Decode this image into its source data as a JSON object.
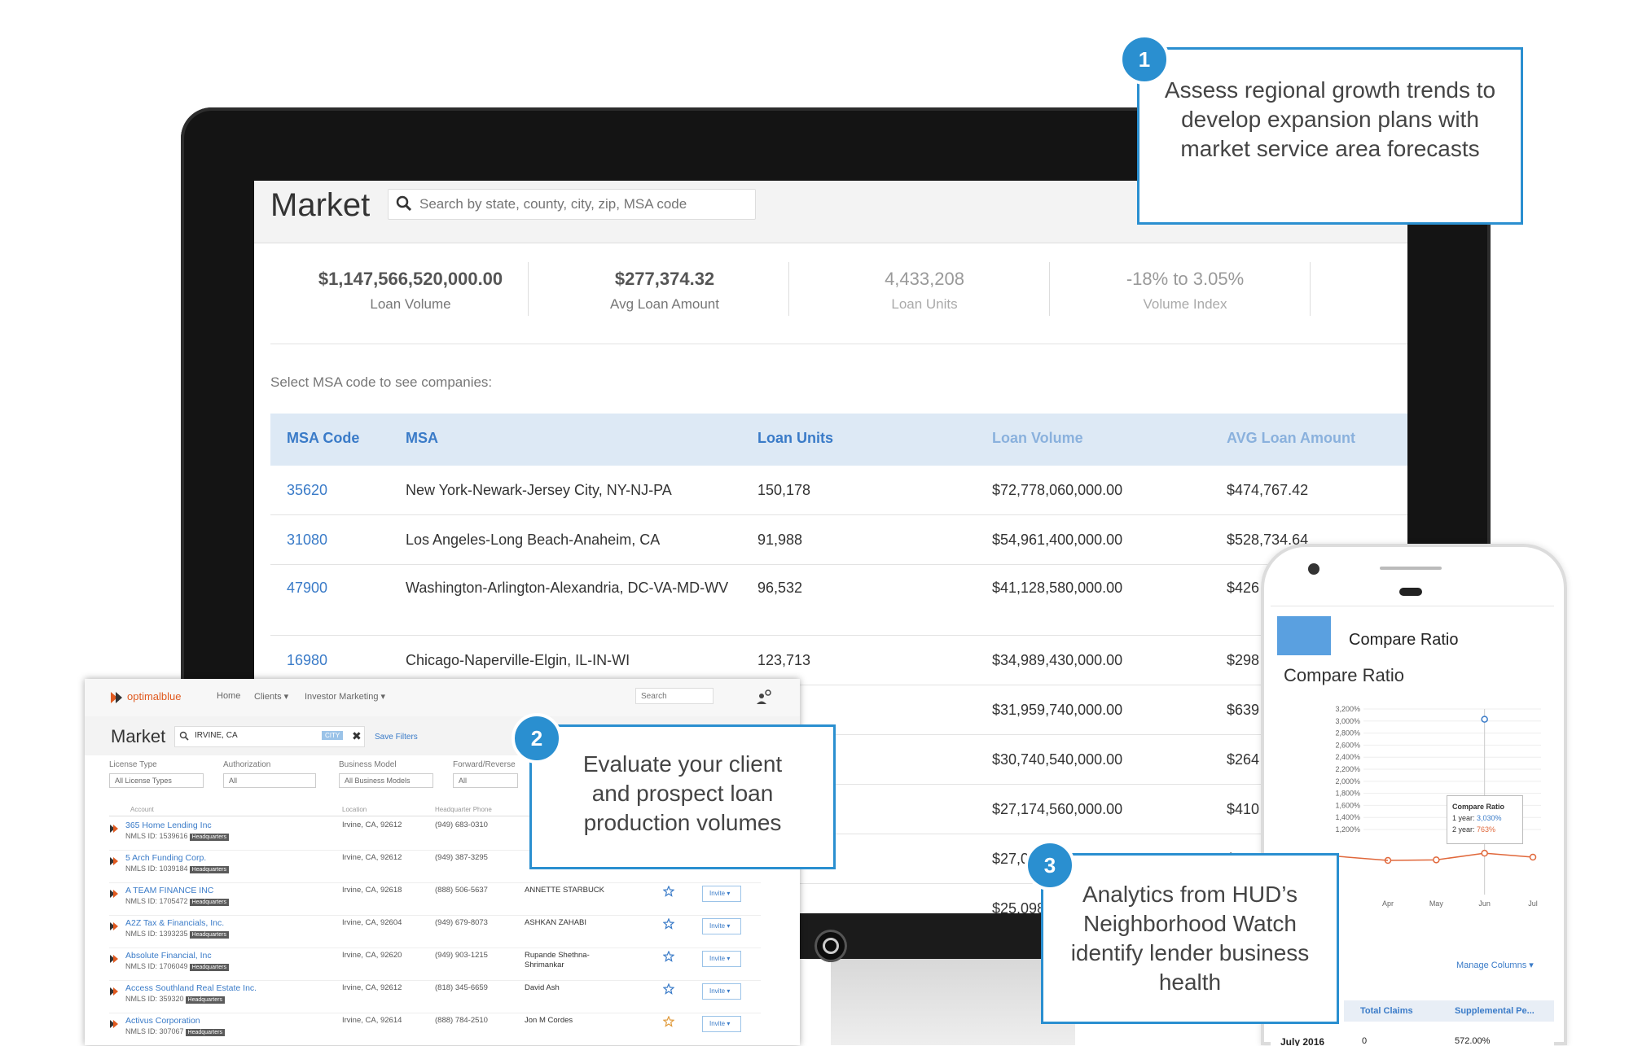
{
  "monitor": {
    "header": {
      "title": "Market",
      "search_placeholder": "Search by state, county, city, zip, MSA code"
    },
    "stats": [
      {
        "value": "$1,147,566,520,000.00",
        "label": "Loan Volume"
      },
      {
        "value": "$277,374.32",
        "label": "Avg Loan Amount"
      },
      {
        "value": "4,433,208",
        "label": "Loan Units"
      },
      {
        "value": "-18% to 3.05%",
        "label": "Volume Index"
      }
    ],
    "select_hint": "Select MSA code to see companies:",
    "table": {
      "headers": [
        "MSA Code",
        "MSA",
        "Loan Units",
        "Loan Volume",
        "AVG Loan Amount"
      ],
      "rows": [
        {
          "code": "35620",
          "msa": "New York-Newark-Jersey City, NY-NJ-PA",
          "units": "150,178",
          "volume": "$72,778,060,000.00",
          "avg": "$474,767.42"
        },
        {
          "code": "31080",
          "msa": "Los Angeles-Long Beach-Anaheim, CA",
          "units": "91,988",
          "volume": "$54,961,400,000.00",
          "avg": "$528,734.64"
        },
        {
          "code": "47900",
          "msa": "Washington-Arlington-Alexandria, DC-VA-MD-WV",
          "units": "96,532",
          "volume": "$41,128,580,000.00",
          "avg": "$426"
        },
        {
          "code": "16980",
          "msa": "Chicago-Naperville-Elgin, IL-IN-WI",
          "units": "123,713",
          "volume": "$34,989,430,000.00",
          "avg": "$298"
        },
        {
          "code": "",
          "msa": "",
          "units": "",
          "volume": "$31,959,740,000.00",
          "avg": "$639"
        },
        {
          "code": "",
          "msa": "",
          "units": "",
          "volume": "$30,740,540,000.00",
          "avg": "$264"
        },
        {
          "code": "",
          "msa": "",
          "units": "",
          "volume": "$27,174,560,000.00",
          "avg": "$410"
        },
        {
          "code": "",
          "msa": "",
          "units": "",
          "volume": "$27,00",
          "avg": "$269"
        },
        {
          "code": "",
          "msa": "",
          "units": "",
          "volume": "$25,098",
          "avg": ""
        }
      ]
    }
  },
  "callouts": [
    {
      "number": "1",
      "text": "Assess regional growth trends to develop expansion plans with market service area forecasts"
    },
    {
      "number": "2",
      "text": "Evaluate your client and prospect loan production volumes"
    },
    {
      "number": "3",
      "text": "Analytics from HUD’s Neighborhood Watch identify lender business health"
    }
  ],
  "app": {
    "logo": "optimalblue",
    "nav": [
      "Home",
      "Clients ▾",
      "Investor Marketing ▾"
    ],
    "search_placeholder": "Search",
    "title": "Market",
    "search_value": "IRVINE, CA",
    "search_tag": "CITY",
    "save_filters": "Save Filters",
    "filters": [
      {
        "label": "License Type",
        "value": "All License Types"
      },
      {
        "label": "Authorization",
        "value": "All"
      },
      {
        "label": "Business Model",
        "value": "All Business Models"
      },
      {
        "label": "Forward/Reverse",
        "value": "All"
      }
    ],
    "columns": [
      "Account",
      "Location",
      "Headquarter Phone"
    ],
    "hq_badge": "Headquarters",
    "invite_label": "Invite ▾",
    "rows": [
      {
        "name": "365 Home Lending Inc",
        "nmls": "NMLS ID: 1539616",
        "loc": "Irvine, CA, 92612",
        "phone": "(949) 683-0310",
        "contact": ""
      },
      {
        "name": "5 Arch Funding Corp.",
        "nmls": "NMLS ID: 1039184",
        "loc": "Irvine, CA, 92612",
        "phone": "(949) 387-3295",
        "contact": ""
      },
      {
        "name": "A TEAM FINANCE INC",
        "nmls": "NMLS ID: 1705472",
        "loc": "Irvine, CA, 92618",
        "phone": "(888) 506-5637",
        "contact": "ANNETTE STARBUCK"
      },
      {
        "name": "A2Z Tax & Financials, Inc.",
        "nmls": "NMLS ID: 1393235",
        "loc": "Irvine, CA, 92604",
        "phone": "(949) 679-8073",
        "contact": "ASHKAN ZAHABI"
      },
      {
        "name": "Absolute Financial, Inc",
        "nmls": "NMLS ID: 1706049",
        "loc": "Irvine, CA, 92620",
        "phone": "(949) 903-1215",
        "contact": "Rupande Shethna-Shrimankar"
      },
      {
        "name": "Access Southland Real Estate Inc.",
        "nmls": "NMLS ID: 359320",
        "loc": "Irvine, CA, 92612",
        "phone": "(818) 345-6659",
        "contact": "David Ash"
      },
      {
        "name": "Activus Corporation",
        "nmls": "NMLS ID: 307067",
        "loc": "Irvine, CA, 92614",
        "phone": "(888) 784-2510",
        "contact": "Jon M Cordes"
      }
    ]
  },
  "phone": {
    "tab_label": "Compare Ratio",
    "title": "Compare Ratio",
    "tooltip": {
      "title": "Compare Ratio",
      "line1_label": "1 year:",
      "line1_value": "3,030%",
      "line2_label": "2 year:",
      "line2_value": "763%"
    },
    "manage_columns": "Manage Columns ▾",
    "table_headers": [
      "Total Claims",
      "Supplemental Pe..."
    ],
    "row": {
      "month": "July 2016",
      "claims": "0",
      "pct": "572.00%"
    }
  },
  "chart_data": {
    "type": "line",
    "title": "Compare Ratio",
    "x": [
      "Apr",
      "May",
      "Jun",
      "Jul"
    ],
    "yticks": [
      "3,200%",
      "3,000%",
      "2,800%",
      "2,600%",
      "2,400%",
      "2,200%",
      "2,000%",
      "1,800%",
      "1,600%",
      "1,400%",
      "1,200%"
    ],
    "ylim": [
      0,
      3200
    ],
    "series": [
      {
        "name": "1 year",
        "color": "#3a7bc8",
        "values": [
          null,
          null,
          3030,
          null
        ]
      },
      {
        "name": "2 year",
        "color": "#e0673a",
        "values": [
          630,
          640,
          763,
          690
        ]
      }
    ]
  }
}
